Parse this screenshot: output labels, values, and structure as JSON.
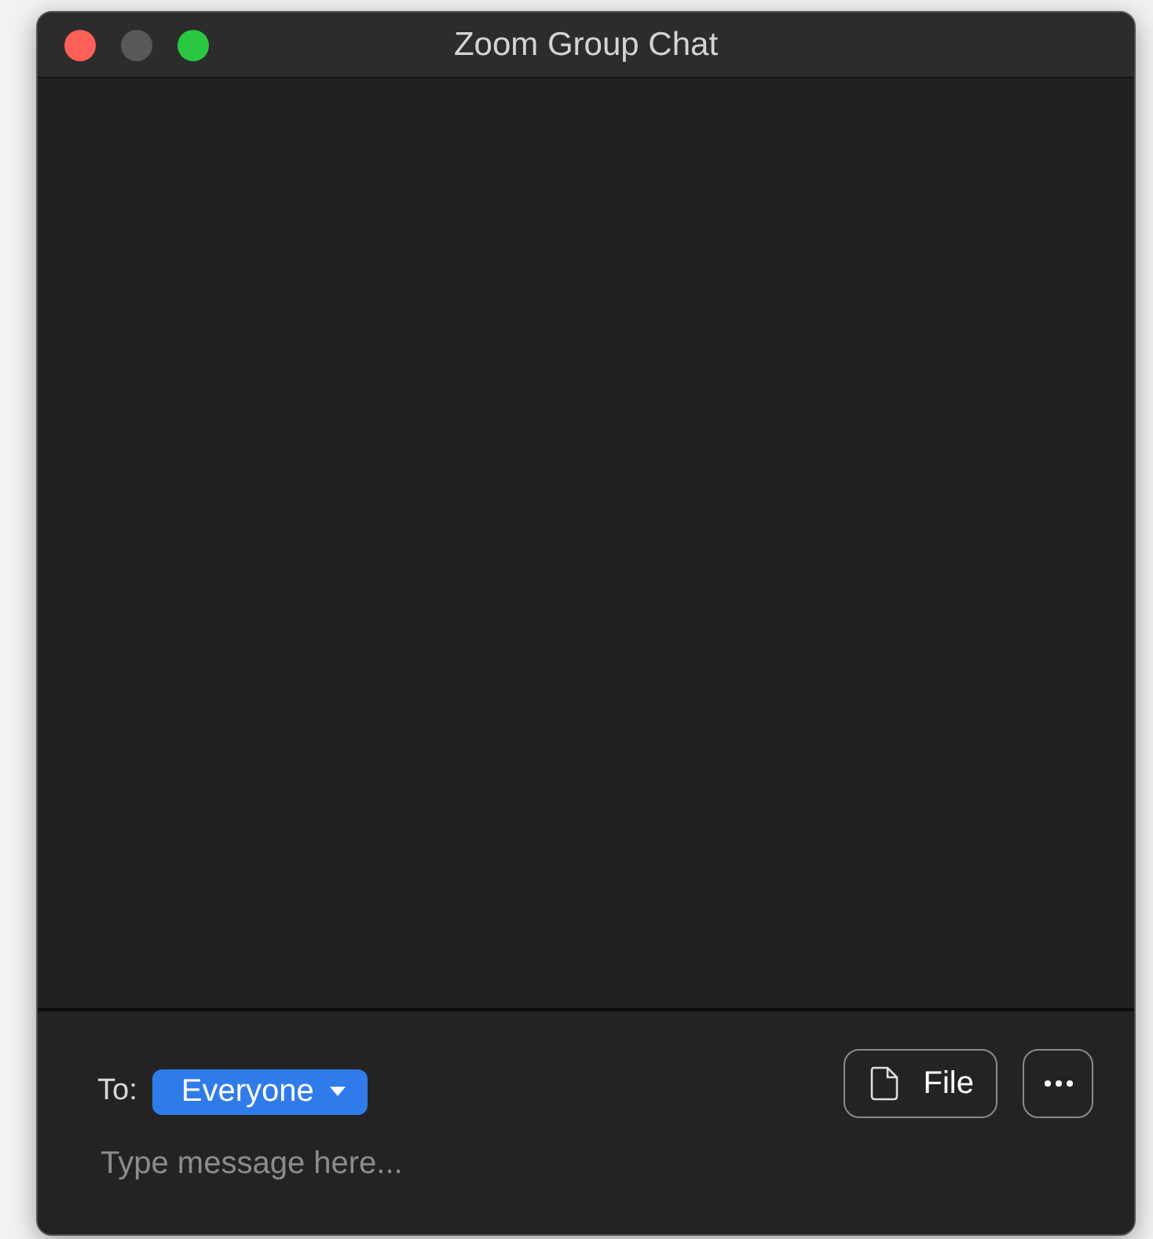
{
  "window": {
    "title": "Zoom Group Chat"
  },
  "recipient": {
    "label": "To:",
    "value": "Everyone"
  },
  "file_button": {
    "label": "File"
  },
  "message_field": {
    "placeholder": "Type message here..."
  }
}
